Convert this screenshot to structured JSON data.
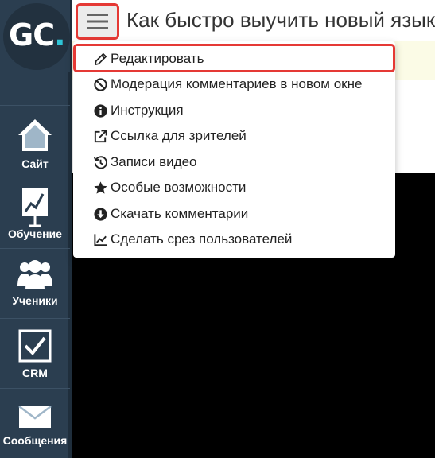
{
  "logo": {
    "main": "GC",
    "dot": "."
  },
  "sidebar": {
    "items": [
      {
        "label": "Сайт",
        "icon": "house-icon"
      },
      {
        "label": "Обучение",
        "icon": "chart-board-icon"
      },
      {
        "label": "Ученики",
        "icon": "people-icon"
      },
      {
        "label": "CRM",
        "icon": "checkbox-icon"
      },
      {
        "label": "Сообщения",
        "icon": "envelope-icon"
      }
    ]
  },
  "header": {
    "title": "Как быстро выучить новый язык",
    "menu_icon": "hamburger-icon"
  },
  "dropdown": {
    "items": [
      {
        "label": "Редактировать",
        "icon": "pencil-icon"
      },
      {
        "label": "Модерация комментариев в новом окне",
        "icon": "ban-icon"
      },
      {
        "label": "Инструкция",
        "icon": "info-icon"
      },
      {
        "label": "Ссылка для зрителей",
        "icon": "external-link-icon"
      },
      {
        "label": "Записи видео",
        "icon": "history-icon"
      },
      {
        "label": "Особые возможности",
        "icon": "star-icon"
      },
      {
        "label": "Скачать комментарии",
        "icon": "download-icon"
      },
      {
        "label": "Сделать срез пользователей",
        "icon": "line-chart-icon"
      }
    ]
  },
  "colors": {
    "sidebar": "#2b3e50",
    "highlight": "#e53935",
    "logo_accent": "#2ec4d6",
    "banner": "#fbfbe6"
  }
}
